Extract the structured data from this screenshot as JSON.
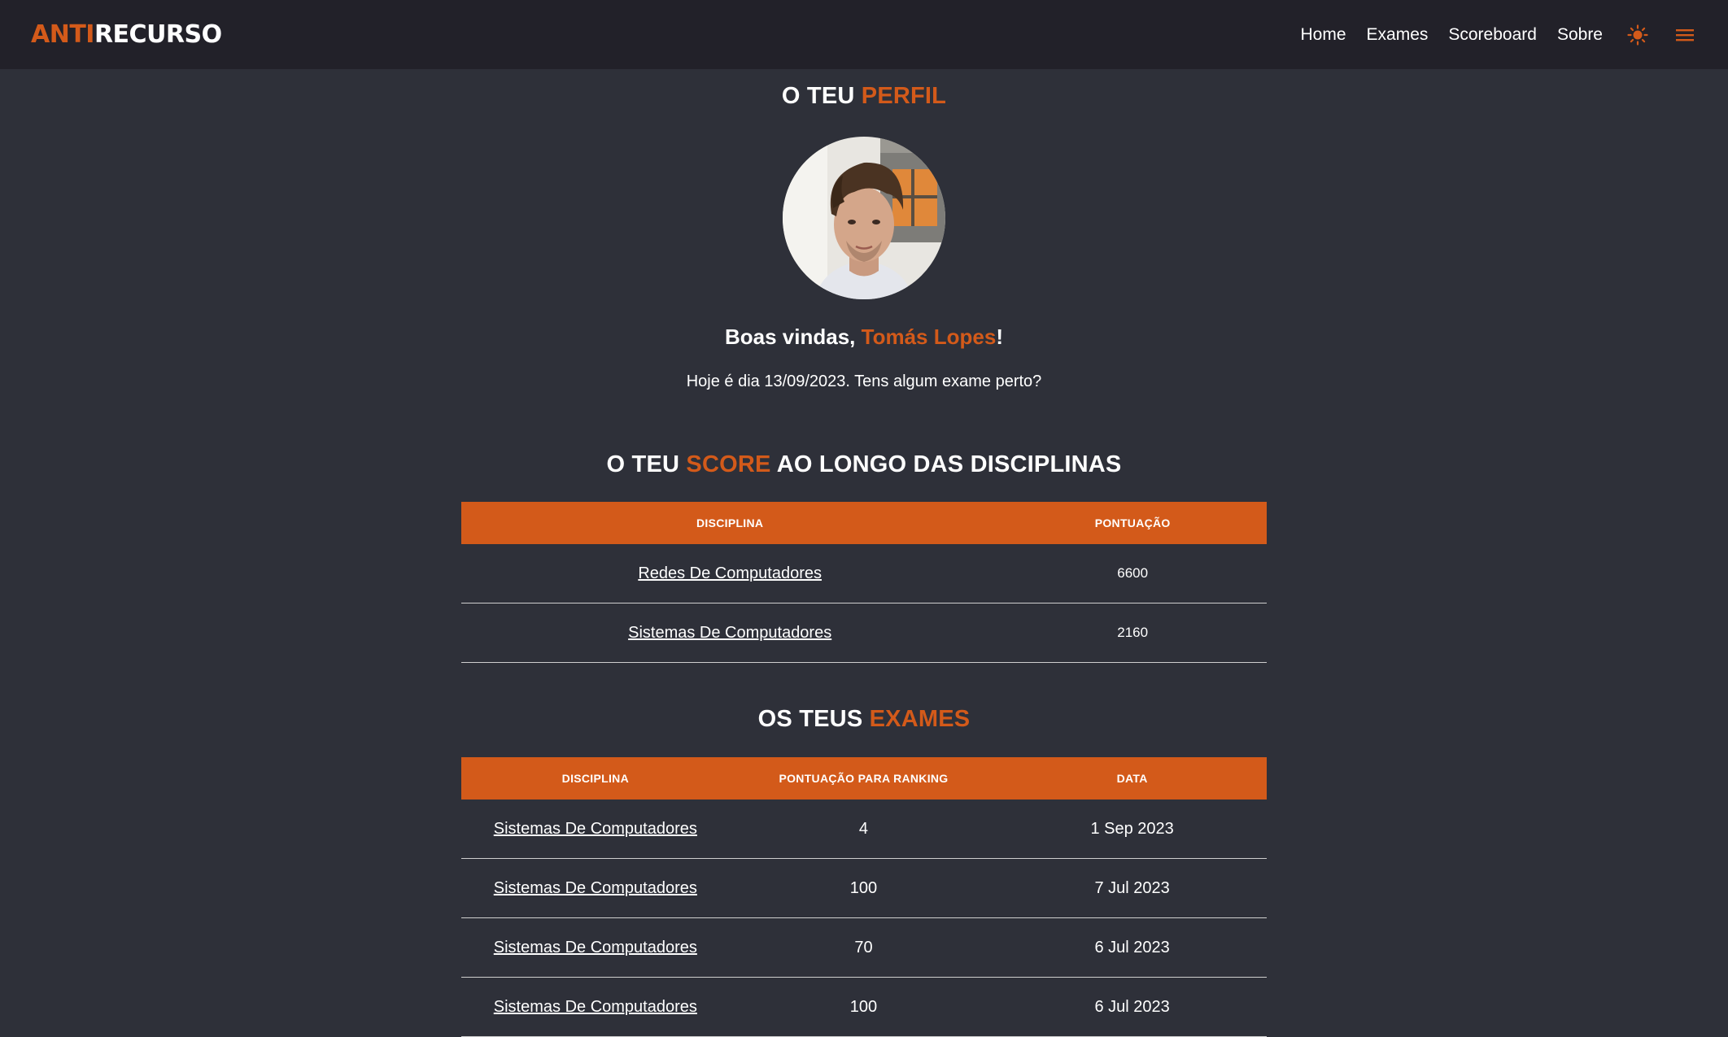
{
  "nav": {
    "logo_accent": "ANTI",
    "logo_rest": "RECURSO",
    "links": [
      "Home",
      "Exames",
      "Scoreboard",
      "Sobre"
    ],
    "theme_icon": "sun-icon",
    "menu_icon": "hamburger-menu-icon"
  },
  "profile": {
    "title_plain": "O TEU",
    "title_accent": "PERFIL",
    "welcome_prefix": "Boas vindas,",
    "user_name": "Tomás Lopes",
    "welcome_suffix": "!",
    "today_text": "Hoje é dia 13/09/2023. Tens algum exame perto?"
  },
  "score": {
    "title_plain": "O TEU",
    "title_accent": "SCORE",
    "title_rest": "AO LONGO DAS DISCIPLINAS",
    "headers": [
      "DISCIPLINA",
      "PONTUAÇÃO"
    ],
    "rows": [
      {
        "discipline": "Redes De Computadores",
        "points": "6600"
      },
      {
        "discipline": "Sistemas De Computadores",
        "points": "2160"
      }
    ]
  },
  "exams": {
    "title_plain": "OS TEUS",
    "title_accent": "EXAMES",
    "headers": [
      "DISCIPLINA",
      "PONTUAÇÃO PARA RANKING",
      "DATA"
    ],
    "rows": [
      {
        "discipline": "Sistemas De Computadores",
        "points": "4",
        "date": "1 Sep 2023"
      },
      {
        "discipline": "Sistemas De Computadores",
        "points": "100",
        "date": "7 Jul 2023"
      },
      {
        "discipline": "Sistemas De Computadores",
        "points": "70",
        "date": "6 Jul 2023"
      },
      {
        "discipline": "Sistemas De Computadores",
        "points": "100",
        "date": "6 Jul 2023"
      }
    ]
  },
  "colors": {
    "accent": "#d35a1a",
    "background": "#2e3039",
    "navbar": "#222129"
  }
}
